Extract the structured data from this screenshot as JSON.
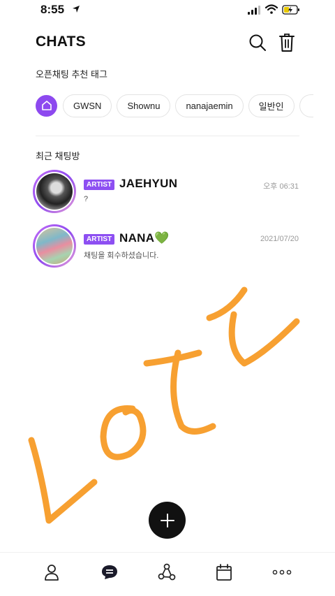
{
  "status_bar": {
    "time": "8:55"
  },
  "header": {
    "title": "CHATS"
  },
  "tags_section": {
    "label": "오픈채팅 추천 태그",
    "tags": [
      "GWSN",
      "Shownu",
      "nanajaemin",
      "일반인"
    ]
  },
  "recent_section": {
    "label": "최근 채팅방"
  },
  "chats": [
    {
      "badge": "ARTIST",
      "name": "JAEHYUN",
      "preview": "?",
      "time": "오후 06:31"
    },
    {
      "badge": "ARTIST",
      "name": "NANA💚",
      "preview": "채팅을 회수하셨습니다.",
      "time": "2021/07/20"
    }
  ],
  "colors": {
    "accent": "#8d49ef",
    "watermark": "#f7a031"
  },
  "icons": [
    "location-arrow-icon",
    "signal-icon",
    "wifi-icon",
    "battery-charging-icon",
    "search-icon",
    "trash-icon",
    "home-icon",
    "plus-icon",
    "person-icon",
    "chat-bubble-icon",
    "share-nodes-icon",
    "calendar-icon",
    "more-dots-icon"
  ]
}
